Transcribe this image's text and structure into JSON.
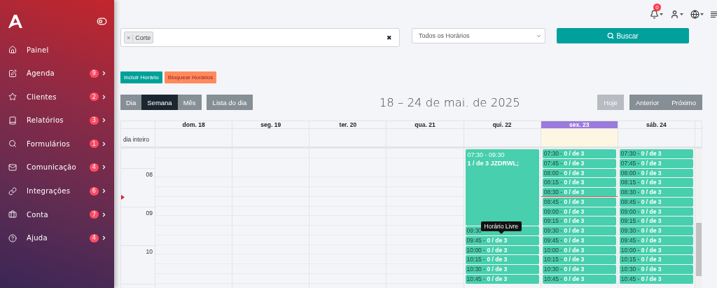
{
  "sidebar": {
    "items": [
      {
        "label": "Painel",
        "expandable": false
      },
      {
        "label": "Agenda",
        "badge": "9",
        "expandable": true
      },
      {
        "label": "Clientes",
        "badge": "2",
        "expandable": true
      },
      {
        "label": "Relatórios",
        "badge": "3",
        "expandable": true
      },
      {
        "label": "Formulários",
        "badge": "1",
        "expandable": true
      },
      {
        "label": "Comunicação",
        "badge": "4",
        "expandable": true
      },
      {
        "label": "Integrações",
        "badge": "6",
        "expandable": true
      },
      {
        "label": "Conta",
        "badge": "7",
        "expandable": true
      },
      {
        "label": "Ajuda",
        "badge": "4",
        "expandable": true
      }
    ]
  },
  "topbar": {
    "notifications": "0"
  },
  "filters": {
    "tags": [
      {
        "label": "Corte",
        "remove": "×"
      }
    ],
    "clear": "✖",
    "select": "Todos os Horários",
    "search_button": "Buscar"
  },
  "actions": [
    {
      "label": "Incluir Horário",
      "kind": "primary"
    },
    {
      "label": "Bloquear Horários",
      "kind": "warning"
    }
  ],
  "views": [
    {
      "label": "Dia",
      "selected": false
    },
    {
      "label": "Semana",
      "selected": true
    },
    {
      "label": "Mês",
      "selected": false
    }
  ],
  "list_button": "Lista do dia",
  "title": "18 – 24 de mai. de 2025",
  "nav": {
    "today": {
      "label": "Hoje",
      "disabled": true
    },
    "buttons": [
      "Anterior",
      "Próximo"
    ]
  },
  "calendar": {
    "all_day_label": "dia inteiro",
    "hours": [
      "08",
      "09",
      "10"
    ],
    "days": [
      {
        "label": "dom. 18",
        "today": false
      },
      {
        "label": "seg. 19",
        "today": false
      },
      {
        "label": "ter. 20",
        "today": false
      },
      {
        "label": "qua. 21",
        "today": false
      },
      {
        "label": "qui. 22",
        "today": false,
        "events": [
          {
            "kind": "block",
            "text": "07:30 - 09:30",
            "detail": "1 / de 3 JZDRWL;"
          },
          {
            "kind": "slot",
            "text": "09:30",
            "tooltip": "Horário Livre"
          },
          {
            "kind": "slot",
            "text": "09:45 - **0 / de 3**"
          },
          {
            "kind": "slot",
            "text": "10:00 - **0 / de 3**"
          },
          {
            "kind": "slot",
            "text": "10:15 - **0 / de 3**"
          },
          {
            "kind": "slot",
            "text": "10:30 - **0 / de 3**"
          },
          {
            "kind": "slot",
            "text": "10:45 - **0 / de 3**"
          }
        ]
      },
      {
        "label": "sex. 23",
        "today": true,
        "events": [
          {
            "kind": "slot",
            "text": "07:30 - **0 / de 3**"
          },
          {
            "kind": "slot",
            "text": "07:45 - **0 / de 3**"
          },
          {
            "kind": "slot",
            "text": "08:00 - **0 / de 3**"
          },
          {
            "kind": "slot",
            "text": "08:15 - **0 / de 3**"
          },
          {
            "kind": "slot",
            "text": "08:30 - **0 / de 3**"
          },
          {
            "kind": "slot",
            "text": "08:45 - **0 / de 3**",
            "now_line": true
          },
          {
            "kind": "slot",
            "text": "09:00 - **0 / de 3**"
          },
          {
            "kind": "slot",
            "text": "09:15 - **0 / de 3**"
          },
          {
            "kind": "slot",
            "text": "09:30 - **0 / de 3**"
          },
          {
            "kind": "slot",
            "text": "09:45 - **0 / de 3**"
          },
          {
            "kind": "slot",
            "text": "10:00 - **0 / de 3**"
          },
          {
            "kind": "slot",
            "text": "10:15 - **0 / de 3**"
          },
          {
            "kind": "slot",
            "text": "10:30 - **0 / de 3**"
          },
          {
            "kind": "slot",
            "text": "10:45 - **0 / de 3**"
          }
        ]
      },
      {
        "label": "sáb. 24",
        "today": false,
        "events": [
          {
            "kind": "slot",
            "text": "07:30 - **0 / de 3**"
          },
          {
            "kind": "slot",
            "text": "07:45 - **0 / de 3**"
          },
          {
            "kind": "slot",
            "text": "08:00 - **0 / de 3**"
          },
          {
            "kind": "slot",
            "text": "08:15 - **0 / de 3**"
          },
          {
            "kind": "slot",
            "text": "08:30 - **0 / de 3**"
          },
          {
            "kind": "slot",
            "text": "08:45 - **0 / de 3**"
          },
          {
            "kind": "slot",
            "text": "09:00 - **0 / de 3**"
          },
          {
            "kind": "slot",
            "text": "09:15 - **0 / de 3**"
          },
          {
            "kind": "slot",
            "text": "09:30 - **0 / de 3**"
          },
          {
            "kind": "slot",
            "text": "09:45 - **0 / de 3**"
          },
          {
            "kind": "slot",
            "text": "10:00 - **0 / de 3**"
          },
          {
            "kind": "slot",
            "text": "10:15 - **0 / de 3**"
          },
          {
            "kind": "slot",
            "text": "10:30 - **0 / de 3**"
          },
          {
            "kind": "slot",
            "text": "10:45 - **0 / de 3**"
          }
        ]
      }
    ]
  }
}
